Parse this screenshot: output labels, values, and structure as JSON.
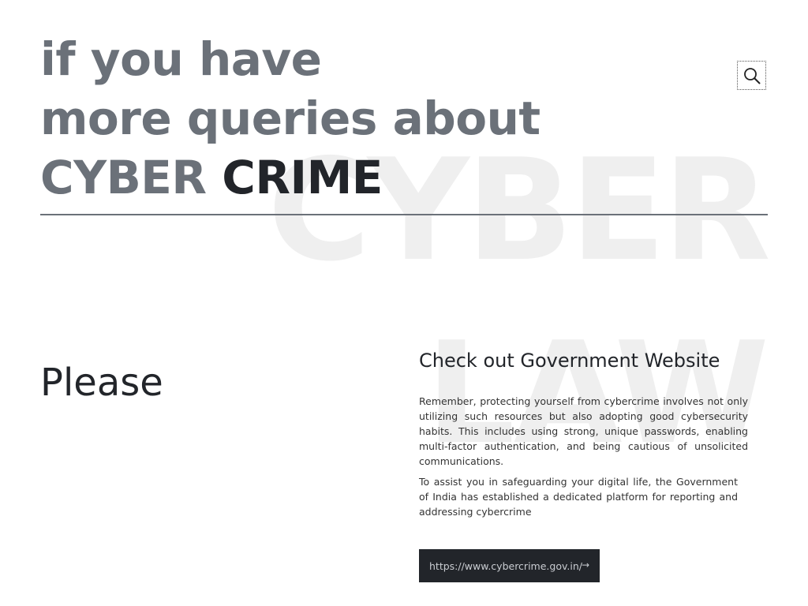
{
  "watermarks": {
    "top": "CYBER",
    "bottom": "LAW"
  },
  "heading": {
    "line1": "if you have",
    "line2": "more queries about",
    "line3_light": "CYBER",
    "line3_dark": "CRIME"
  },
  "header": {
    "search_icon": "search-icon"
  },
  "left": {
    "please": "Please"
  },
  "government": {
    "title": "Check out Government Website",
    "paragraph1": "Remember, protecting yourself from cybercrime involves not only utilizing such resources but also adopting good cybersecurity habits. This includes using strong, unique passwords, enabling multi-factor authentication, and being cautious of unsolicited communications.",
    "paragraph2": "To assist you in safeguarding your digital life, the Government of India has established a dedicated platform for reporting and addressing cybercrime",
    "link_label": "https://www.cybercrime.gov.in/",
    "link_arrow": "→"
  },
  "colors": {
    "heading_gray": "#6b7179",
    "heading_dark": "#22252a",
    "watermark": "#efefef",
    "button_bg": "#22252a"
  }
}
